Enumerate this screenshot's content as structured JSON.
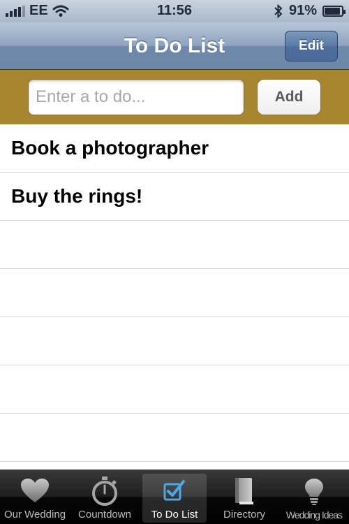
{
  "status_bar": {
    "carrier": "EE",
    "time": "11:56",
    "battery": "91%",
    "battery_level": 0.91
  },
  "nav": {
    "title": "To Do List",
    "edit_label": "Edit"
  },
  "input": {
    "placeholder": "Enter a to do...",
    "value": "",
    "add_label": "Add"
  },
  "todos": [
    {
      "text": "Book a photographer"
    },
    {
      "text": "Buy the rings!"
    },
    {
      "text": ""
    },
    {
      "text": ""
    },
    {
      "text": ""
    },
    {
      "text": ""
    },
    {
      "text": ""
    },
    {
      "text": ""
    }
  ],
  "tabs": [
    {
      "label": "Our Wedding",
      "icon": "heart-icon",
      "active": false
    },
    {
      "label": "Countdown",
      "icon": "stopwatch-icon",
      "active": false
    },
    {
      "label": "To Do List",
      "icon": "checkbox-icon",
      "active": true
    },
    {
      "label": "Directory",
      "icon": "book-icon",
      "active": false
    },
    {
      "label": "Wedding Ideas",
      "icon": "lightbulb-icon",
      "active": false
    }
  ],
  "colors": {
    "nav_blue": "#7f96b6",
    "input_bar_gold": "#a8862f",
    "tab_active_blue": "#4aa8e8",
    "tab_icon_grey": "#9a9a9a"
  }
}
